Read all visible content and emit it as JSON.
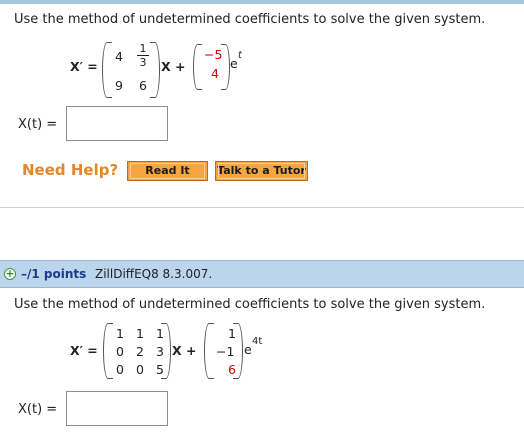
{
  "problem1": {
    "instruction": "Use the method of undetermined coefficients to solve the given system.",
    "lhs": "X′ =",
    "matrix": {
      "r1c1": "4",
      "r1c2_num": "1",
      "r1c2_den": "3",
      "r2c1": "9",
      "r2c2": "6"
    },
    "x_plus": "X +",
    "vector": [
      "−5",
      "4"
    ],
    "exp_base": "e",
    "exp_power": "t",
    "answer_label": "X(t) =",
    "answer_value": "",
    "need_help": "Need Help?",
    "read_it": "Read It",
    "talk_tutor": "Talk to a Tutor"
  },
  "problem2": {
    "points": "–/1 points",
    "problem_id": "ZillDiffEQ8 8.3.007.",
    "instruction": "Use the method of undetermined coefficients to solve the given system.",
    "lhs": "X′ =",
    "matrix": [
      [
        "1",
        "1",
        "1"
      ],
      [
        "0",
        "2",
        "3"
      ],
      [
        "0",
        "0",
        "5"
      ]
    ],
    "x_plus": "X +",
    "vector": [
      "1",
      "−1",
      "6"
    ],
    "exp_base": "e",
    "exp_power": "4t",
    "answer_label": "X(t) =",
    "answer_value": ""
  },
  "colors": {
    "header_bar": "#bcd4ec",
    "need_help": "#e4862a",
    "button": "#f7a53f",
    "points_text": "#1a3e8c",
    "highlight_red": "#dd0000"
  },
  "icons": {
    "expand": "plus-circle-icon"
  }
}
